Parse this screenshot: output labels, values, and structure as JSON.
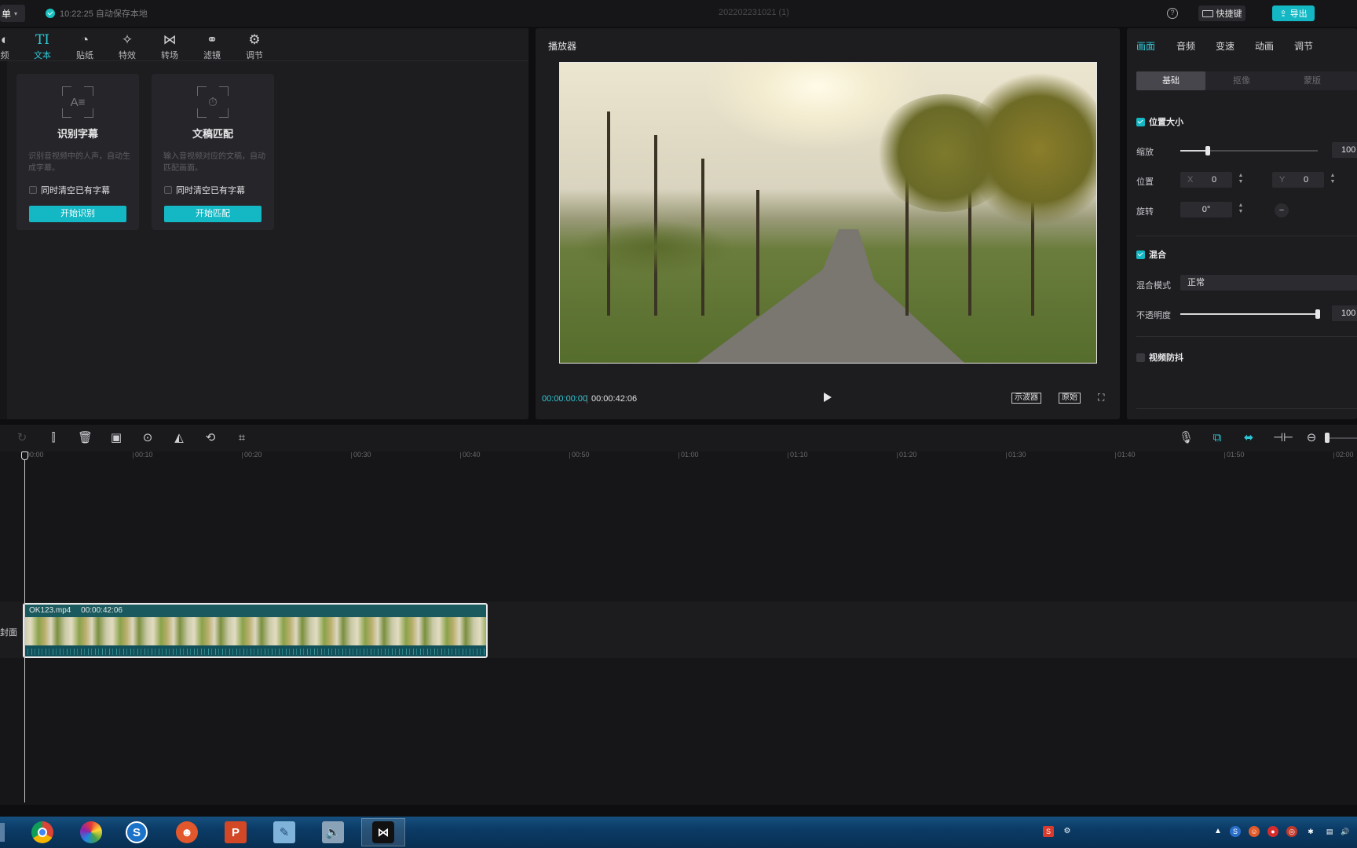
{
  "topbar": {
    "menu_label": "单",
    "autosave_text": "10:22:25 自动保存本地",
    "project_title": "202202231021 (1)",
    "shortcut_label": "快捷键",
    "export_label": "导出"
  },
  "media_tabs": [
    {
      "label": "频",
      "icon": "media-icon"
    },
    {
      "label": "文本",
      "icon": "text-icon"
    },
    {
      "label": "贴纸",
      "icon": "sticker-icon"
    },
    {
      "label": "特效",
      "icon": "effects-icon"
    },
    {
      "label": "转场",
      "icon": "transition-icon"
    },
    {
      "label": "滤镜",
      "icon": "filter-icon"
    },
    {
      "label": "调节",
      "icon": "adjust-icon"
    }
  ],
  "cards": [
    {
      "title": "识别字幕",
      "desc": "识别音视频中的人声，自动生成字幕。",
      "option": "同时清空已有字幕",
      "button": "开始识别",
      "glyph": "A≡"
    },
    {
      "title": "文稿匹配",
      "desc": "输入音视频对应的文稿，自动匹配画面。",
      "option": "同时清空已有字幕",
      "button": "开始匹配",
      "glyph": "⏱"
    }
  ],
  "player": {
    "title": "播放器",
    "time_current": "00:00:00:00",
    "time_total": "00:00:42:06",
    "oscilloscope_label": "示波器",
    "original_label": "原始"
  },
  "inspector": {
    "tabs": [
      "画面",
      "音频",
      "变速",
      "动画",
      "调节"
    ],
    "subtabs": [
      "基础",
      "抠像",
      "蒙版"
    ],
    "position_size": {
      "heading": "位置大小",
      "scale_label": "缩放",
      "scale_value": "100",
      "scale_level": 0.2,
      "position_label": "位置",
      "x_label": "X",
      "x_value": "0",
      "y_label": "Y",
      "y_value": "0",
      "rotate_label": "旋转",
      "rotate_value": "0°"
    },
    "blend": {
      "heading": "混合",
      "mode_label": "混合模式",
      "mode_value": "正常",
      "opacity_label": "不透明度",
      "opacity_value": "100",
      "opacity_level": 1.0
    },
    "stabilize": {
      "heading": "视频防抖"
    }
  },
  "timeline": {
    "ruler": [
      "00:00",
      "00:10",
      "00:20",
      "00:30",
      "00:40",
      "00:50",
      "01:00",
      "01:10",
      "01:20",
      "01:30",
      "01:40",
      "01:50",
      "02:00"
    ],
    "cover_label": "封面",
    "clip": {
      "name": "OK123.mp4",
      "duration": "00:00:42:06"
    }
  },
  "taskbar": {
    "apps": [
      "chrome-icon",
      "colorful-browser-icon",
      "sogou-icon",
      "mascot-app-icon",
      "powerpoint-icon",
      "notepad-icon",
      "speaker-app-icon",
      "capcut-icon"
    ]
  },
  "colors": {
    "accent": "#13b8c4",
    "panel": "#1d1d20",
    "background": "#0e0e10"
  }
}
